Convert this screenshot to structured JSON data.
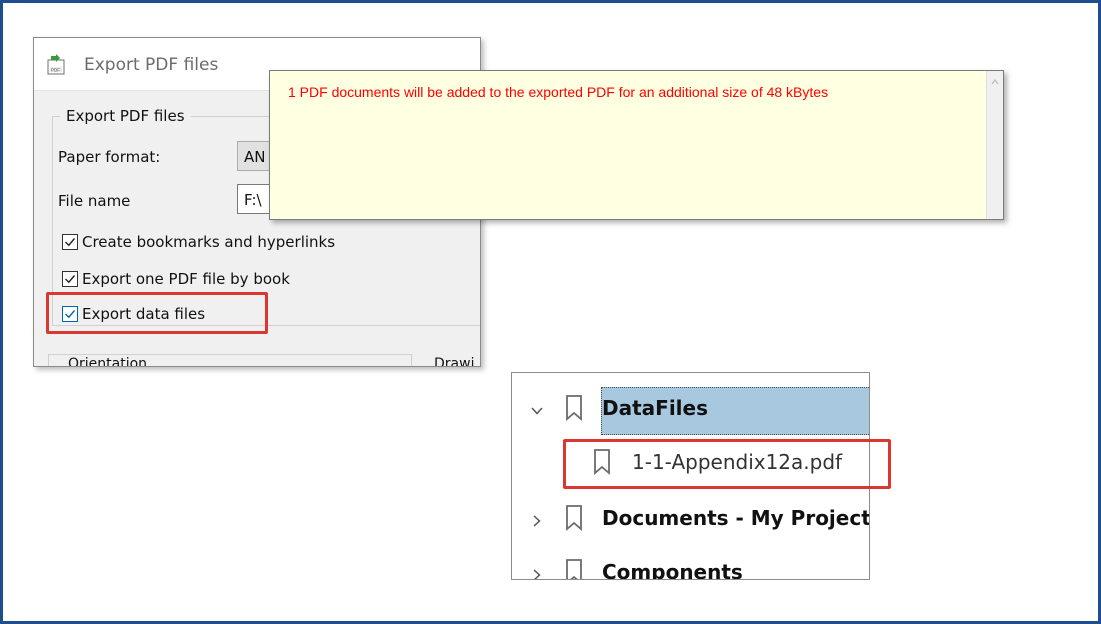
{
  "dialog": {
    "title": "Export PDF files",
    "group_title": "Export PDF files",
    "paper_format_label": "Paper format:",
    "paper_format_value": "AN",
    "file_name_label": "File name",
    "file_name_value": "F:\\",
    "checkboxes": [
      {
        "label": "Create bookmarks and hyperlinks",
        "checked": true
      },
      {
        "label": "Export one PDF file by book",
        "checked": true
      },
      {
        "label": "Export data files",
        "checked": true
      }
    ],
    "orientation_label": "Orientation",
    "drawing_label": "Drawi"
  },
  "popup": {
    "message": "1 PDF documents will be added to the exported PDF for an additional size of 48 kBytes",
    "text_color": "#ff0000",
    "background": "#ffffe1"
  },
  "tree": {
    "items": [
      {
        "label": "DataFiles",
        "expanded": true,
        "selected": true,
        "bold": true,
        "icon": "bookmark-icon"
      },
      {
        "label": "1-1-Appendix12a.pdf",
        "child": true,
        "icon": "bookmark-icon"
      },
      {
        "label": "Documents - My Project",
        "expanded": false,
        "bold": true,
        "icon": "bookmark-icon"
      },
      {
        "label": "Components",
        "expanded": false,
        "bold": true,
        "icon": "bookmark-icon"
      }
    ]
  },
  "colors": {
    "frame_border": "#1f4e8c",
    "highlight": "#d9372f",
    "selection": "#a8c8e0",
    "checkbox_accent": "#0063b1"
  }
}
